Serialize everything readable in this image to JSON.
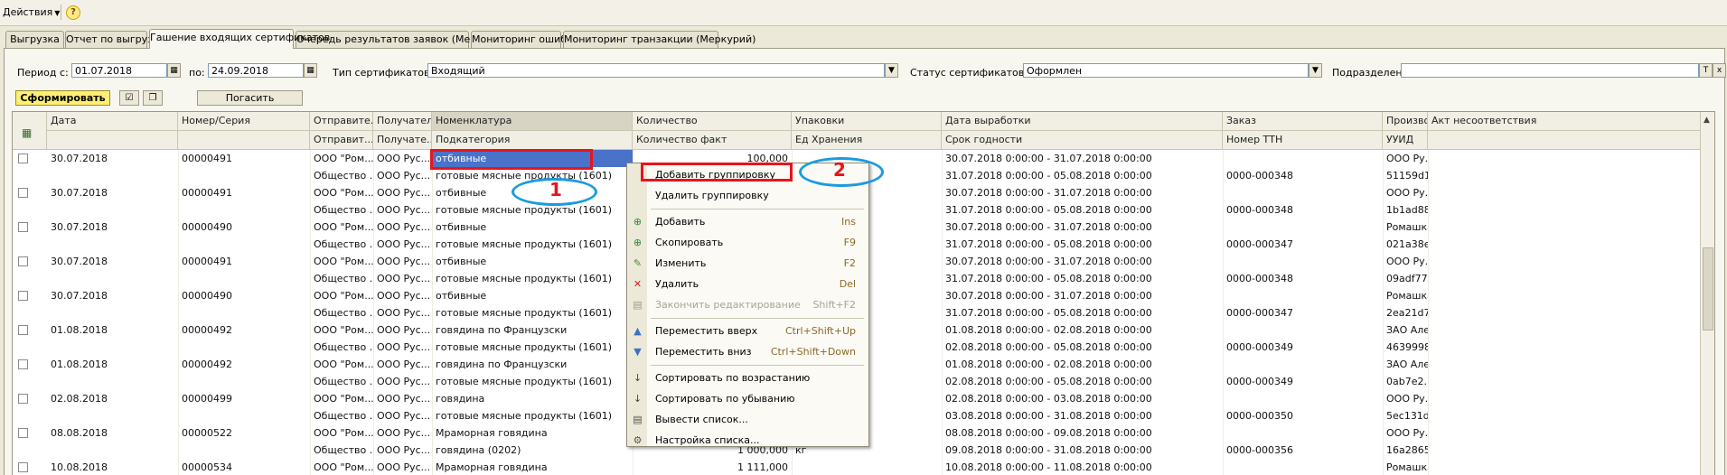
{
  "topbar": {
    "actions_label": "Действия",
    "help_label": "?"
  },
  "tabs": [
    {
      "label": "Выгрузка"
    },
    {
      "label": "Отчет по выгрузке"
    },
    {
      "label": "Гашение входящих сертификатов"
    },
    {
      "label": "Очередь результатов заявок (Меркурий)"
    },
    {
      "label": "Мониторинг ошибок"
    },
    {
      "label": "Мониторинг транзакции (Меркурий)"
    }
  ],
  "filters": {
    "period_from_label": "Период с:",
    "period_from_value": "01.07.2018",
    "period_to_label": "по:",
    "period_to_value": "24.09.2018",
    "cert_type_label": "Тип сертификатов:",
    "cert_type_value": "Входящий",
    "cert_status_label": "Статус сертификатов:",
    "cert_status_value": "Оформлен",
    "department_label": "Подразделение:",
    "department_value": "",
    "clear_button_label": "T",
    "select_button_label": "x"
  },
  "toolbar": {
    "form_label": "Сформировать",
    "pay_label": "Погасить"
  },
  "grid": {
    "header_top": [
      "Дата",
      "Номер/Серия",
      "Отправите...",
      "Получатель",
      "Номенклатура",
      "Количество",
      "Упаковки",
      "Дата выработки",
      "Заказ",
      "Произво...",
      "Акт несоответствия"
    ],
    "header_bottom": [
      "",
      "",
      "Отправит...",
      "Получате...",
      "Подкатегория",
      "Количество факт",
      "Ед Хранения",
      "Срок годности",
      "Номер ТТН",
      "УУИД",
      ""
    ],
    "rows": [
      {
        "date": "30.07.2018",
        "num": "00000491",
        "sender": "ООО \"Ром...",
        "receiver": "ООО Рус...",
        "nom": "отбивные",
        "qty": "100,000",
        "pack": "",
        "produced": "30.07.2018 0:00:00 - 31.07.2018 0:00:00",
        "order": "",
        "producer": "ООО Ру...",
        "sender2": "Общество ...",
        "receiver2": "ООО Рус...",
        "subcat": "готовые мясные продукты (1601)",
        "qtyfact": "",
        "unit": "",
        "expiry": "31.07.2018 0:00:00 - 05.08.2018 0:00:00",
        "ttn": "0000-000348",
        "uuid": "51159d1..."
      },
      {
        "date": "30.07.2018",
        "num": "00000491",
        "sender": "ООО \"Ром...",
        "receiver": "ООО Рус...",
        "nom": "отбивные",
        "qty": "",
        "pack": "",
        "produced": "30.07.2018 0:00:00 - 31.07.2018 0:00:00",
        "order": "",
        "producer": "ООО Ру...",
        "sender2": "Общество ...",
        "receiver2": "ООО Рус...",
        "subcat": "готовые мясные продукты (1601)",
        "qtyfact": "",
        "unit": "",
        "expiry": "31.07.2018 0:00:00 - 05.08.2018 0:00:00",
        "ttn": "0000-000348",
        "uuid": "1b1ad88..."
      },
      {
        "date": "30.07.2018",
        "num": "00000490",
        "sender": "ООО \"Ром...",
        "receiver": "ООО Рус...",
        "nom": "отбивные",
        "qty": "",
        "pack": "",
        "produced": "30.07.2018 0:00:00 - 31.07.2018 0:00:00",
        "order": "",
        "producer": "Ромашка",
        "sender2": "Общество ...",
        "receiver2": "ООО Рус...",
        "subcat": "готовые мясные продукты (1601)",
        "qtyfact": "",
        "unit": "",
        "expiry": "31.07.2018 0:00:00 - 05.08.2018 0:00:00",
        "ttn": "0000-000347",
        "uuid": "021a38e..."
      },
      {
        "date": "30.07.2018",
        "num": "00000491",
        "sender": "ООО \"Ром...",
        "receiver": "ООО Рус...",
        "nom": "отбивные",
        "qty": "",
        "pack": "",
        "produced": "30.07.2018 0:00:00 - 31.07.2018 0:00:00",
        "order": "",
        "producer": "ООО Ру...",
        "sender2": "Общество ...",
        "receiver2": "ООО Рус...",
        "subcat": "готовые мясные продукты (1601)",
        "qtyfact": "",
        "unit": "",
        "expiry": "31.07.2018 0:00:00 - 05.08.2018 0:00:00",
        "ttn": "0000-000348",
        "uuid": "09adf77..."
      },
      {
        "date": "30.07.2018",
        "num": "00000490",
        "sender": "ООО \"Ром...",
        "receiver": "ООО Рус...",
        "nom": "отбивные",
        "qty": "",
        "pack": "",
        "produced": "30.07.2018 0:00:00 - 31.07.2018 0:00:00",
        "order": "",
        "producer": "Ромашка",
        "sender2": "Общество ...",
        "receiver2": "ООО Рус...",
        "subcat": "готовые мясные продукты (1601)",
        "qtyfact": "",
        "unit": "",
        "expiry": "31.07.2018 0:00:00 - 05.08.2018 0:00:00",
        "ttn": "0000-000347",
        "uuid": "2ea21d7..."
      },
      {
        "date": "01.08.2018",
        "num": "00000492",
        "sender": "ООО \"Ром...",
        "receiver": "ООО Рус...",
        "nom": "говядина по Французски",
        "qty": "",
        "pack": "",
        "produced": "01.08.2018 0:00:00 - 02.08.2018 0:00:00",
        "order": "",
        "producer": "ЗАО Але...",
        "sender2": "Общество ...",
        "receiver2": "ООО Рус...",
        "subcat": "готовые мясные продукты (1601)",
        "qtyfact": "",
        "unit": "",
        "expiry": "02.08.2018 0:00:00 - 05.08.2018 0:00:00",
        "ttn": "0000-000349",
        "uuid": "4639998..."
      },
      {
        "date": "01.08.2018",
        "num": "00000492",
        "sender": "ООО \"Ром...",
        "receiver": "ООО Рус...",
        "nom": "говядина по Французски",
        "qty": "",
        "pack": "",
        "produced": "01.08.2018 0:00:00 - 02.08.2018 0:00:00",
        "order": "",
        "producer": "ЗАО Але...",
        "sender2": "Общество ...",
        "receiver2": "ООО Рус...",
        "subcat": "готовые мясные продукты (1601)",
        "qtyfact": "",
        "unit": "",
        "expiry": "02.08.2018 0:00:00 - 05.08.2018 0:00:00",
        "ttn": "0000-000349",
        "uuid": "0ab7e2..."
      },
      {
        "date": "02.08.2018",
        "num": "00000499",
        "sender": "ООО \"Ром...",
        "receiver": "ООО Рус...",
        "nom": "говядина",
        "qty": "",
        "pack": "",
        "produced": "02.08.2018 0:00:00 - 03.08.2018 0:00:00",
        "order": "",
        "producer": "ООО Ру...",
        "sender2": "Общество ...",
        "receiver2": "ООО Рус...",
        "subcat": "готовые мясные продукты (1601)",
        "qtyfact": "",
        "unit": "",
        "expiry": "03.08.2018 0:00:00 - 31.08.2018 0:00:00",
        "ttn": "0000-000350",
        "uuid": "5ec131d..."
      },
      {
        "date": "08.08.2018",
        "num": "00000522",
        "sender": "ООО \"Ром...",
        "receiver": "ООО Рус...",
        "nom": "Мраморная говядина",
        "qty": "",
        "pack": "",
        "produced": "08.08.2018 0:00:00 - 09.08.2018 0:00:00",
        "order": "",
        "producer": "ООО Ру...",
        "sender2": "Общество ...",
        "receiver2": "ООО Рус...",
        "subcat": "говядина (0202)",
        "qtyfact": "1 000,000",
        "unit": "кг",
        "expiry": "09.08.2018 0:00:00 - 31.08.2018 0:00:00",
        "ttn": "0000-000356",
        "uuid": "16a2865..."
      },
      {
        "date": "10.08.2018",
        "num": "00000534",
        "sender": "ООО \"Ром...",
        "receiver": "ООО Рус...",
        "nom": "Мраморная говядина",
        "qty": "1 111,000",
        "pack": "",
        "produced": "10.08.2018 0:00:00 - 11.08.2018 0:00:00",
        "order": "",
        "producer": "Ромашка",
        "sender2": "",
        "receiver2": "",
        "subcat": "",
        "qtyfact": "",
        "unit": "",
        "expiry": "",
        "ttn": "",
        "uuid": ""
      }
    ]
  },
  "context_menu": {
    "items": [
      {
        "label": "Добавить группировку",
        "shortcut": "",
        "icon": "none",
        "disabled": false
      },
      {
        "label": "Удалить группировку",
        "shortcut": "",
        "icon": "none",
        "disabled": false
      },
      {
        "sep": true
      },
      {
        "label": "Добавить",
        "shortcut": "Ins",
        "icon": "add-icon",
        "disabled": false
      },
      {
        "label": "Скопировать",
        "shortcut": "F9",
        "icon": "copy-icon",
        "disabled": false
      },
      {
        "label": "Изменить",
        "shortcut": "F2",
        "icon": "edit-icon",
        "disabled": false
      },
      {
        "label": "Удалить",
        "shortcut": "Del",
        "icon": "delete-icon",
        "disabled": false
      },
      {
        "label": "Закончить редактирование",
        "shortcut": "Shift+F2",
        "icon": "end-edit-icon",
        "disabled": true
      },
      {
        "sep": true
      },
      {
        "label": "Переместить вверх",
        "shortcut": "Ctrl+Shift+Up",
        "icon": "move-up-icon",
        "disabled": false
      },
      {
        "label": "Переместить вниз",
        "shortcut": "Ctrl+Shift+Down",
        "icon": "move-down-icon",
        "disabled": false
      },
      {
        "sep": true
      },
      {
        "label": "Сортировать по возрастанию",
        "shortcut": "",
        "icon": "sort-asc-icon",
        "disabled": false
      },
      {
        "label": "Сортировать по убыванию",
        "shortcut": "",
        "icon": "sort-desc-icon",
        "disabled": false
      },
      {
        "label": "Вывести список...",
        "shortcut": "",
        "icon": "print-list-icon",
        "disabled": false
      },
      {
        "label": "Настройка списка...",
        "shortcut": "",
        "icon": "list-settings-icon",
        "disabled": false
      }
    ]
  },
  "annotations": {
    "label_1": "1",
    "label_2": "2"
  },
  "colors": {
    "selection": "#4a72c9",
    "annotation_red": "#e8141c",
    "annotation_blue": "#1a9be0",
    "form_button": "#ffef74"
  }
}
